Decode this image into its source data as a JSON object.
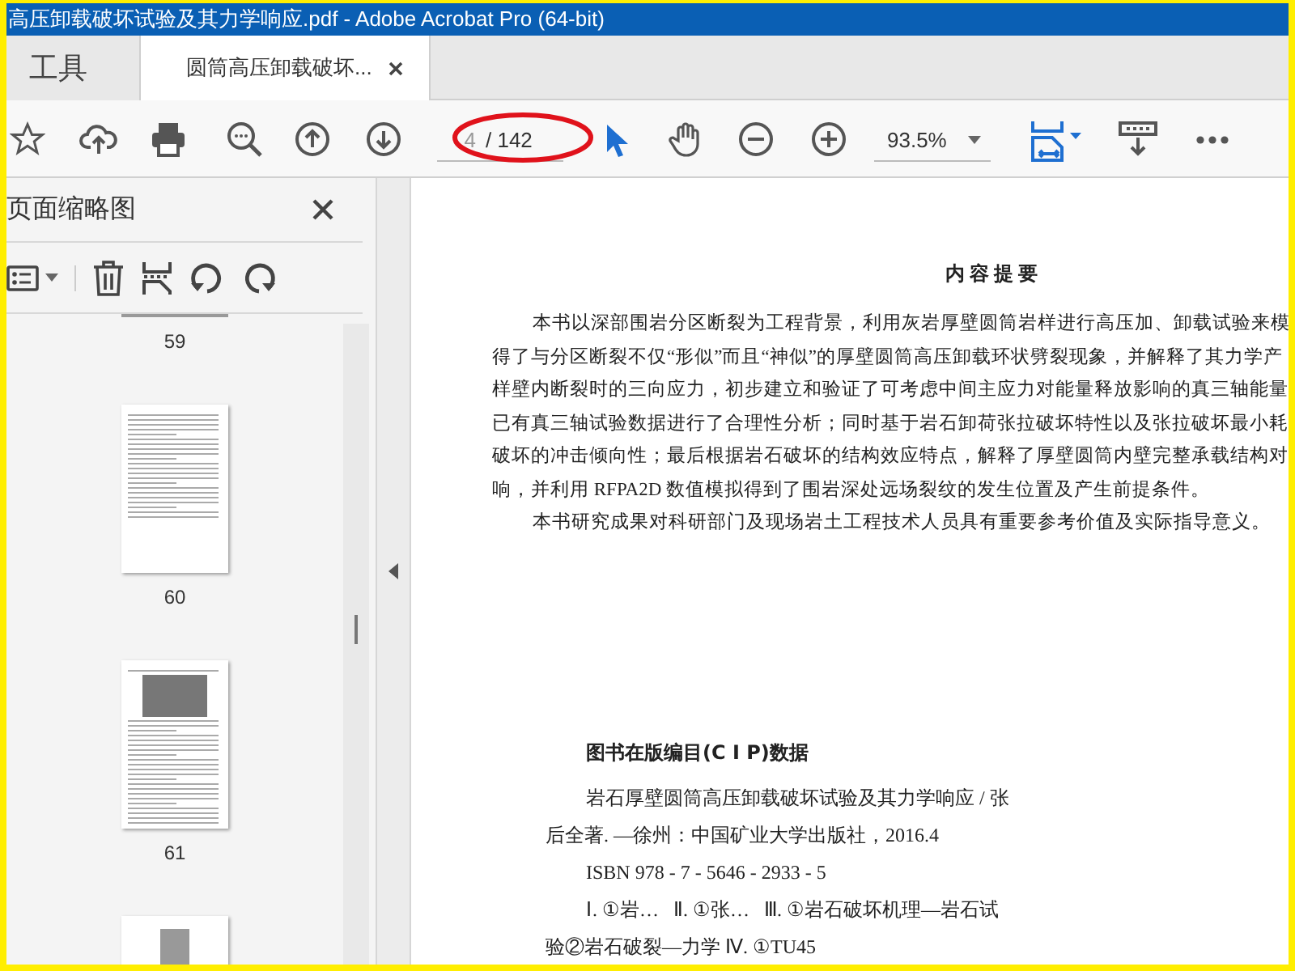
{
  "window": {
    "title": "高压卸载破坏试验及其力学响应.pdf - Adobe Acrobat Pro (64-bit)"
  },
  "tabs": [
    {
      "label": "工具",
      "selected": false,
      "closable": false
    },
    {
      "label": "圆筒高压卸载破坏...",
      "selected": true,
      "closable": true
    }
  ],
  "toolbar": {
    "page_field": {
      "value": "4",
      "total": "/ 142"
    },
    "zoom": {
      "value": "93.5%"
    }
  },
  "sidebar": {
    "title": "页面缩略图",
    "thumbnails": [
      {
        "label": "59",
        "kind": "cut"
      },
      {
        "label": "60",
        "kind": "text"
      },
      {
        "label": "61",
        "kind": "photo"
      }
    ]
  },
  "document": {
    "heading": "内 容 提 要",
    "paragraphs": [
      {
        "lines": [
          "本书以深部围岩分区断裂为工程背景，利用灰岩厚壁圆筒岩样进行高压加、卸载试验来模",
          "得了与分区断裂不仅“形似”而且“神似”的厚壁圆筒高压卸载环状劈裂现象，并解释了其力学产",
          "样壁内断裂时的三向应力，初步建立和验证了可考虑中间主应力对能量释放影响的真三轴能量",
          "已有真三轴试验数据进行了合理性分析；同时基于岩石卸荷张拉破坏特性以及张拉破坏最小耗",
          "破坏的冲击倾向性；最后根据岩石破坏的结构效应特点，解释了厚壁圆筒内壁完整承载结构对",
          "响，并利用 RFPA2D 数值模拟得到了围岩深处远场裂纹的发生位置及产生前提条件。"
        ]
      },
      {
        "lines": [
          "本书研究成果对科研部门及现场岩土工程技术人员具有重要参考价值及实际指导意义。"
        ]
      }
    ],
    "cip_heading": "图书在版编目(C I P)数据",
    "cip_entries": [
      {
        "lines": [
          "岩石厚壁圆筒高压卸载破坏试验及其力学响应 / 张",
          "后全著. —徐州：中国矿业大学出版社，2016.4"
        ]
      },
      {
        "lines": [
          "ISBN 978 - 7 - 5646 - 2933 - 5"
        ]
      },
      {
        "lines": [
          "Ⅰ. ①岩…   Ⅱ. ①张…   Ⅲ. ①岩石破坏机理—岩石试",
          "验②岩石破裂—力学 Ⅳ. ①TU45"
        ]
      }
    ]
  }
}
